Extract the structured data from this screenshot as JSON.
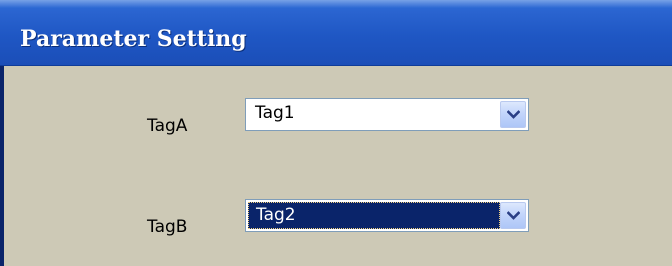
{
  "window": {
    "title": "Parameter Setting"
  },
  "fields": [
    {
      "label": "TagA",
      "value": "Tag1",
      "focused": false,
      "dropdown_icon": "chevron-down-icon"
    },
    {
      "label": "TagB",
      "value": "Tag2",
      "focused": true,
      "dropdown_icon": "chevron-down-icon"
    }
  ],
  "colors": {
    "titlebar": "#1f57c4",
    "panel": "#cdc9b6",
    "selection": "#0a246a",
    "combo_border": "#7f9db9"
  }
}
